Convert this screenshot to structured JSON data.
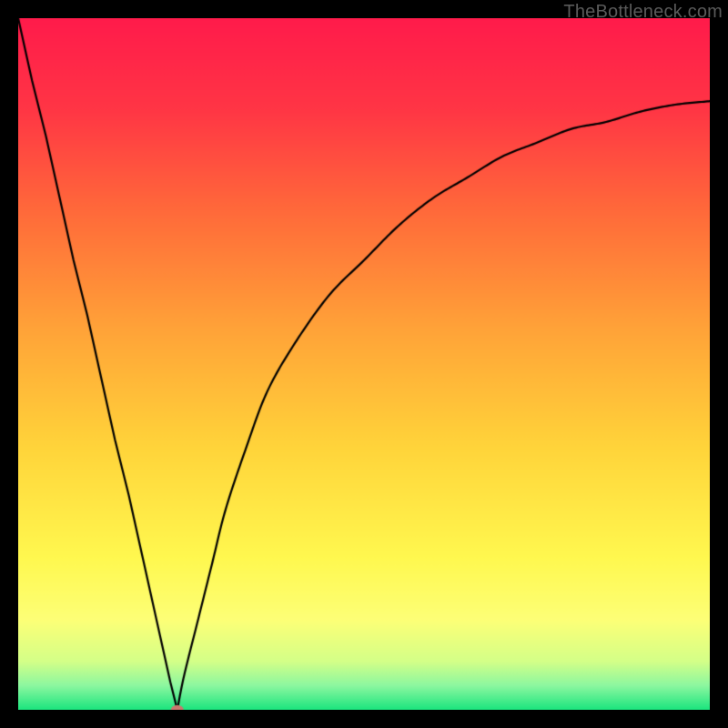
{
  "watermark": "TheBottleneck.com",
  "chart_data": {
    "type": "line",
    "title": "",
    "xlabel": "",
    "ylabel": "",
    "xlim": [
      0,
      100
    ],
    "ylim": [
      0,
      100
    ],
    "grid": false,
    "background_gradient_stops": [
      {
        "offset": 0,
        "color": "#ff1b4b"
      },
      {
        "offset": 0.13,
        "color": "#ff3545"
      },
      {
        "offset": 0.28,
        "color": "#ff6a3a"
      },
      {
        "offset": 0.45,
        "color": "#ffa338"
      },
      {
        "offset": 0.62,
        "color": "#ffd43a"
      },
      {
        "offset": 0.78,
        "color": "#fff84f"
      },
      {
        "offset": 0.87,
        "color": "#fdff77"
      },
      {
        "offset": 0.93,
        "color": "#d4ff88"
      },
      {
        "offset": 0.965,
        "color": "#8cf7a0"
      },
      {
        "offset": 1.0,
        "color": "#1be57e"
      }
    ],
    "series": [
      {
        "name": "bottleneck-curve",
        "x": [
          0,
          2,
          4,
          6,
          8,
          10,
          12,
          14,
          16,
          18,
          20,
          22,
          23,
          24,
          26,
          28,
          30,
          33,
          36,
          40,
          45,
          50,
          55,
          60,
          65,
          70,
          75,
          80,
          85,
          90,
          95,
          100
        ],
        "y": [
          100,
          91,
          83,
          74,
          65,
          57,
          48,
          39,
          31,
          22,
          13,
          4,
          0,
          5,
          13,
          21,
          29,
          38,
          46,
          53,
          60,
          65,
          70,
          74,
          77,
          80,
          82,
          84,
          85,
          86.5,
          87.5,
          88
        ]
      }
    ],
    "marker": {
      "x": 23,
      "y": 0,
      "color": "#c9786e",
      "radius_px": 7
    }
  }
}
